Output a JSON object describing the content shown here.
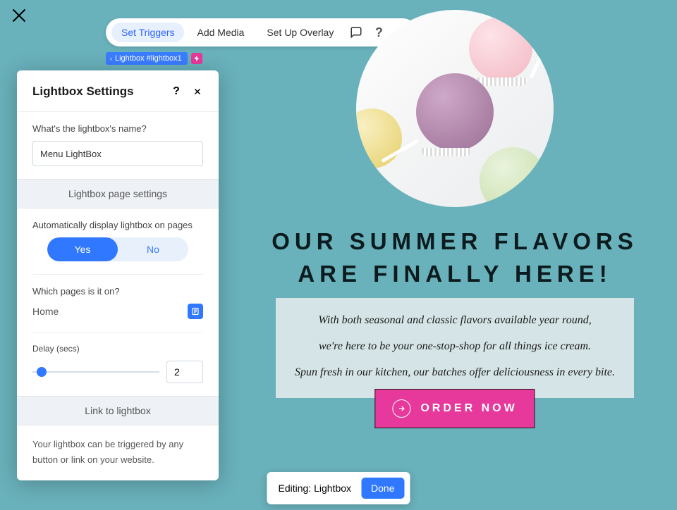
{
  "toolbar": {
    "tabs": [
      "Set Triggers",
      "Add Media",
      "Set Up Overlay"
    ]
  },
  "breadcrumb": {
    "label": "Lightbox #lightbox1"
  },
  "panel": {
    "title": "Lightbox Settings",
    "name_label": "What's the lightbox's name?",
    "name_value": "Menu LightBox",
    "page_settings_heading": "Lightbox page settings",
    "auto_display_label": "Automatically display lightbox on pages",
    "toggle_yes": "Yes",
    "toggle_no": "No",
    "which_pages_label": "Which pages is it on?",
    "which_pages_value": "Home",
    "delay_label": "Delay (secs)",
    "delay_value": "2",
    "link_heading": "Link to lightbox",
    "link_note": "Your lightbox can be triggered by any button or link on your website."
  },
  "content": {
    "headline_line1": "OUR SUMMER FLAVORS",
    "headline_line2": "ARE FINALLY HERE!",
    "subcopy_line1": "With both seasonal and classic flavors available year round,",
    "subcopy_line2": "we're here to be your one-stop-shop for all things ice cream.",
    "subcopy_line3": "Spun fresh in our kitchen, our batches offer deliciousness in every bite.",
    "cta_label": "ORDER NOW"
  },
  "status": {
    "editing_label": "Editing: Lightbox",
    "done_label": "Done"
  }
}
